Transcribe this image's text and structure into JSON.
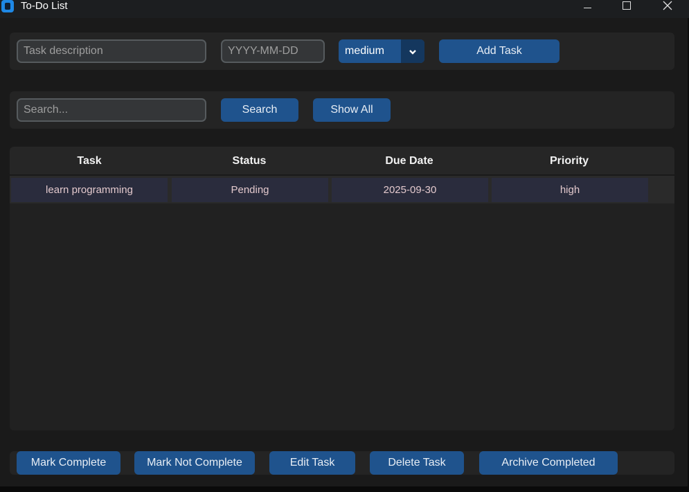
{
  "window": {
    "title": "To-Do List"
  },
  "add_form": {
    "description_placeholder": "Task description",
    "date_placeholder": "YYYY-MM-DD",
    "priority_selected": "medium",
    "add_button": "Add Task"
  },
  "search_bar": {
    "placeholder": "Search...",
    "search_button": "Search",
    "show_all_button": "Show All"
  },
  "table": {
    "columns": [
      "Task",
      "Status",
      "Due Date",
      "Priority"
    ],
    "rows": [
      {
        "task": "learn programming",
        "status": "Pending",
        "due_date": "2025-09-30",
        "priority": "high"
      }
    ]
  },
  "actions": {
    "mark_complete": "Mark Complete",
    "mark_not_complete": "Mark Not Complete",
    "edit_task": "Edit Task",
    "delete_task": "Delete Task",
    "archive_completed": "Archive Completed"
  },
  "colors": {
    "accent_button": "#1f538d",
    "combo_arrow_bg": "#14375e",
    "row_cell_bg": "#2a2c3d",
    "row_text": "#e3c9cd",
    "window_bg": "#1a1a1a",
    "panel_bg": "#242424"
  },
  "icons": {
    "app": "app-icon",
    "minimize": "minimize-icon",
    "maximize": "maximize-icon",
    "close": "close-icon",
    "dropdown": "chevron-down-icon"
  }
}
